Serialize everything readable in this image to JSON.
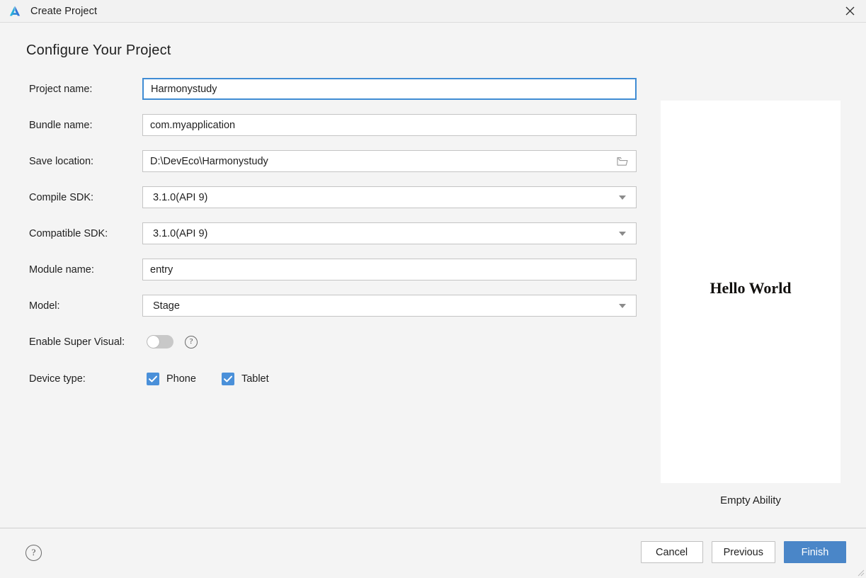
{
  "window": {
    "title": "Create Project",
    "logo_icon": "deveco-logo-icon",
    "close_icon": "close-icon"
  },
  "page": {
    "heading": "Configure Your Project"
  },
  "form": {
    "fields": [
      {
        "label": "Project name:",
        "value": "Harmonystudy",
        "type": "text",
        "focused": true
      },
      {
        "label": "Bundle name:",
        "value": "com.myapplication",
        "type": "text",
        "focused": false
      },
      {
        "label": "Save location:",
        "value": "D:\\DevEco\\Harmonystudy",
        "type": "path",
        "focused": false,
        "icon": "folder-icon"
      },
      {
        "label": "Compile SDK:",
        "value": "3.1.0(API 9)",
        "type": "select",
        "focused": false,
        "icon": "chevron-down-icon"
      },
      {
        "label": "Compatible SDK:",
        "value": "3.1.0(API 9)",
        "type": "select",
        "focused": false,
        "icon": "chevron-down-icon"
      },
      {
        "label": "Module name:",
        "value": "entry",
        "type": "text",
        "focused": false
      },
      {
        "label": "Model:",
        "value": "Stage",
        "type": "select",
        "focused": false,
        "icon": "chevron-down-icon"
      }
    ],
    "super_visual": {
      "label": "Enable Super Visual:",
      "enabled": false,
      "help_icon": "help-circle-icon",
      "help_glyph": "?"
    },
    "device_type": {
      "label": "Device type:",
      "options": [
        {
          "label": "Phone",
          "checked": true
        },
        {
          "label": "Tablet",
          "checked": true
        }
      ]
    }
  },
  "preview": {
    "screen_text": "Hello World",
    "caption": "Empty Ability"
  },
  "footer": {
    "help_icon": "help-circle-icon",
    "help_glyph": "?",
    "buttons": [
      {
        "label": "Cancel",
        "primary": false
      },
      {
        "label": "Previous",
        "primary": false
      },
      {
        "label": "Finish",
        "primary": true
      }
    ]
  },
  "colors": {
    "accent": "#4a90d9",
    "primary_button": "#4a86c8",
    "focus_border": "#3f8cd4",
    "background": "#f4f4f4"
  }
}
